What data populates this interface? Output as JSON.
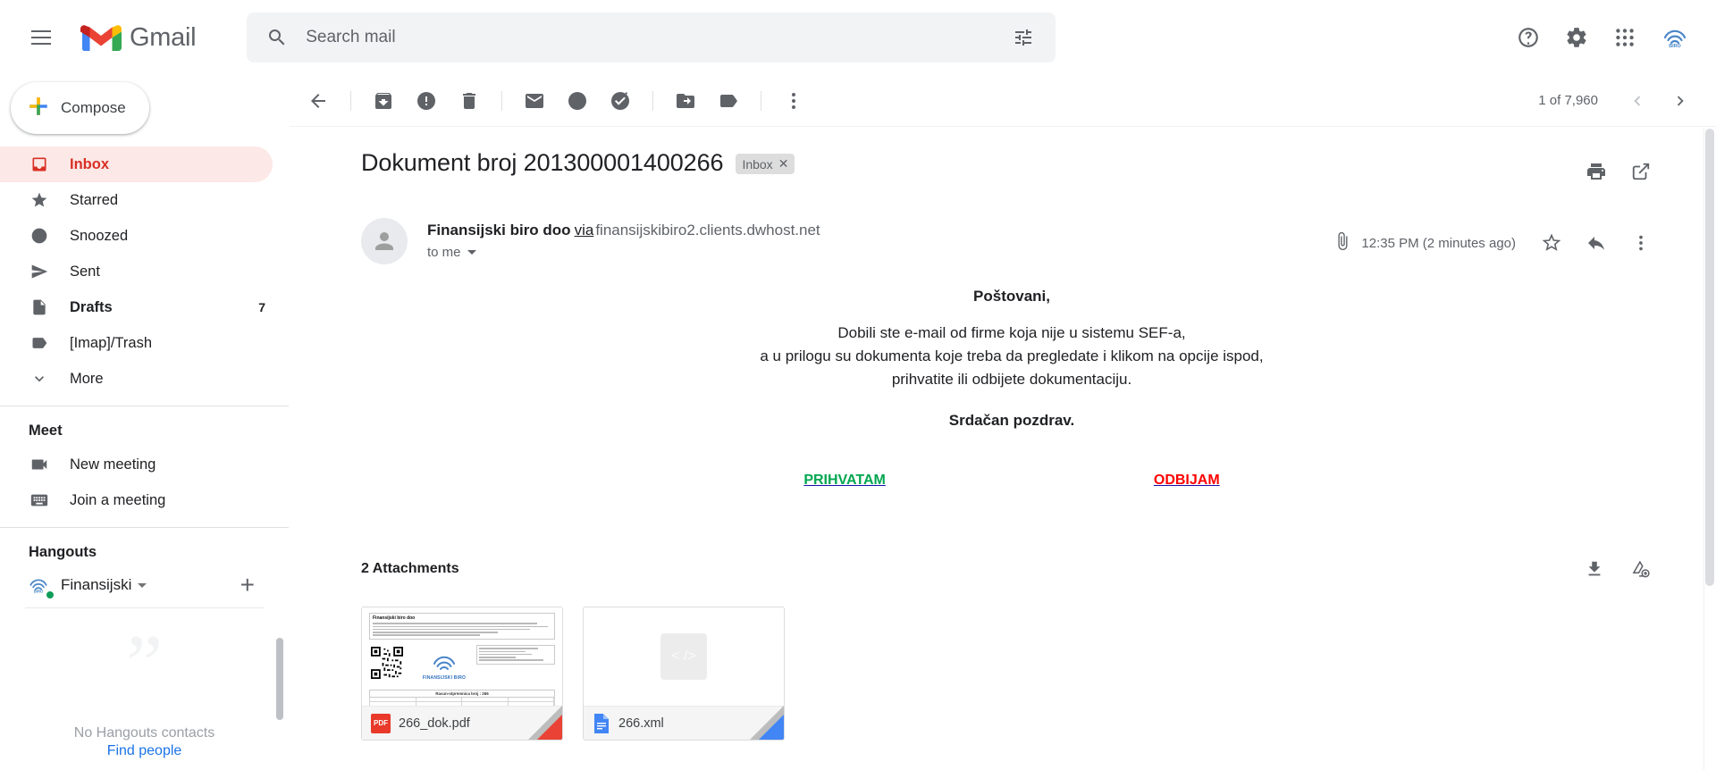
{
  "app": {
    "brand": "Gmail",
    "hamburger_icon": "hamburger-menu-icon",
    "logo_icon": "gmail-logo-icon"
  },
  "search": {
    "placeholder": "Search mail",
    "value": "",
    "search_icon": "search-icon",
    "options_icon": "search-options-icon"
  },
  "topright": {
    "help_icon": "help-question-icon",
    "settings_icon": "gear-icon",
    "apps_icon": "google-apps-grid-icon",
    "account_icon": "account-avatar-icon"
  },
  "sidebar": {
    "compose_label": "Compose",
    "compose_icon": "plus-icon",
    "items": [
      {
        "label": "Inbox",
        "icon": "inbox-icon",
        "count": "",
        "active": true,
        "bold": false
      },
      {
        "label": "Starred",
        "icon": "star-icon",
        "count": "",
        "active": false,
        "bold": false
      },
      {
        "label": "Snoozed",
        "icon": "clock-icon",
        "count": "",
        "active": false,
        "bold": false
      },
      {
        "label": "Sent",
        "icon": "send-icon",
        "count": "",
        "active": false,
        "bold": false
      },
      {
        "label": "Drafts",
        "icon": "draft-icon",
        "count": "7",
        "active": false,
        "bold": true
      },
      {
        "label": "[Imap]/Trash",
        "icon": "label-icon",
        "count": "",
        "active": false,
        "bold": false
      },
      {
        "label": "More",
        "icon": "chevron-down-icon",
        "count": "",
        "active": false,
        "bold": false
      }
    ],
    "meet": {
      "title": "Meet",
      "items": [
        {
          "label": "New meeting",
          "icon": "video-camera-icon"
        },
        {
          "label": "Join a meeting",
          "icon": "keyboard-icon"
        }
      ]
    },
    "hangouts": {
      "title": "Hangouts",
      "user": "Finansijski",
      "status": "online",
      "add_icon": "plus-icon",
      "empty_line1": "No Hangouts contacts",
      "empty_line2": "Find people",
      "quote_icon": "hangouts-quote-icon"
    }
  },
  "toolbar": {
    "back_icon": "back-arrow-icon",
    "archive_icon": "archive-icon",
    "spam_icon": "report-spam-icon",
    "delete_icon": "trash-icon",
    "unread_icon": "mark-unread-icon",
    "snooze_icon": "snooze-clock-icon",
    "tasks_icon": "add-to-tasks-icon",
    "moveto_icon": "move-to-folder-icon",
    "labels_icon": "labels-tag-icon",
    "more_icon": "more-vertical-icon",
    "pagination": "1 of 7,960",
    "prev_icon": "chevron-left-icon",
    "next_icon": "chevron-right-icon"
  },
  "message": {
    "subject": "Dokument broj 201300001400266",
    "label_chip": "Inbox",
    "label_chip_close_icon": "close-x-icon",
    "print_icon": "print-icon",
    "popout_icon": "open-in-new-window-icon",
    "sender_name": "Finansijski biro doo",
    "via_label": "via",
    "via_domain": "finansijskibiro2.clients.dwhost.net",
    "recipient": "to me",
    "recipient_caret_icon": "chevron-down-icon",
    "attachment_clip_icon": "paperclip-icon",
    "timestamp": "12:35 PM (2 minutes ago)",
    "star_icon": "star-outline-icon",
    "reply_icon": "reply-arrow-icon",
    "more_icon": "more-vertical-icon",
    "body": {
      "greeting": "Poštovani,",
      "paragraph_lines": [
        "Dobili ste e-mail od firme koja nije u sistemu SEF-a,",
        "a u prilogu su dokumenta koje treba da pregledate i klikom na opcije ispod,",
        "prihvatite ili odbijete dokumentaciju."
      ],
      "signoff": "Srdačan pozdrav.",
      "accept_label": "PRIHVATAM",
      "reject_label": "ODBIJAM",
      "accept_color": "#00a650",
      "reject_color": "#ff0000",
      "link_underline_color": "#1a0dab"
    }
  },
  "attachments": {
    "heading": "2 Attachments",
    "download_all_icon": "download-icon",
    "save_to_drive_icon": "save-to-drive-icon",
    "items": [
      {
        "name": "266_dok.pdf",
        "type": "pdf",
        "file_icon": "pdf-file-icon",
        "corner_color": "#ea4335",
        "preview_title": "Finansijski biro doo",
        "preview_logo": "FINANSIJSKI BIRO",
        "preview_doc_line": "Racun-otpremnica broj : 266"
      },
      {
        "name": "266.xml",
        "type": "xml",
        "file_icon": "xml-file-icon",
        "corner_color": "#4285f4",
        "preview_glyph": "< />"
      }
    ]
  }
}
